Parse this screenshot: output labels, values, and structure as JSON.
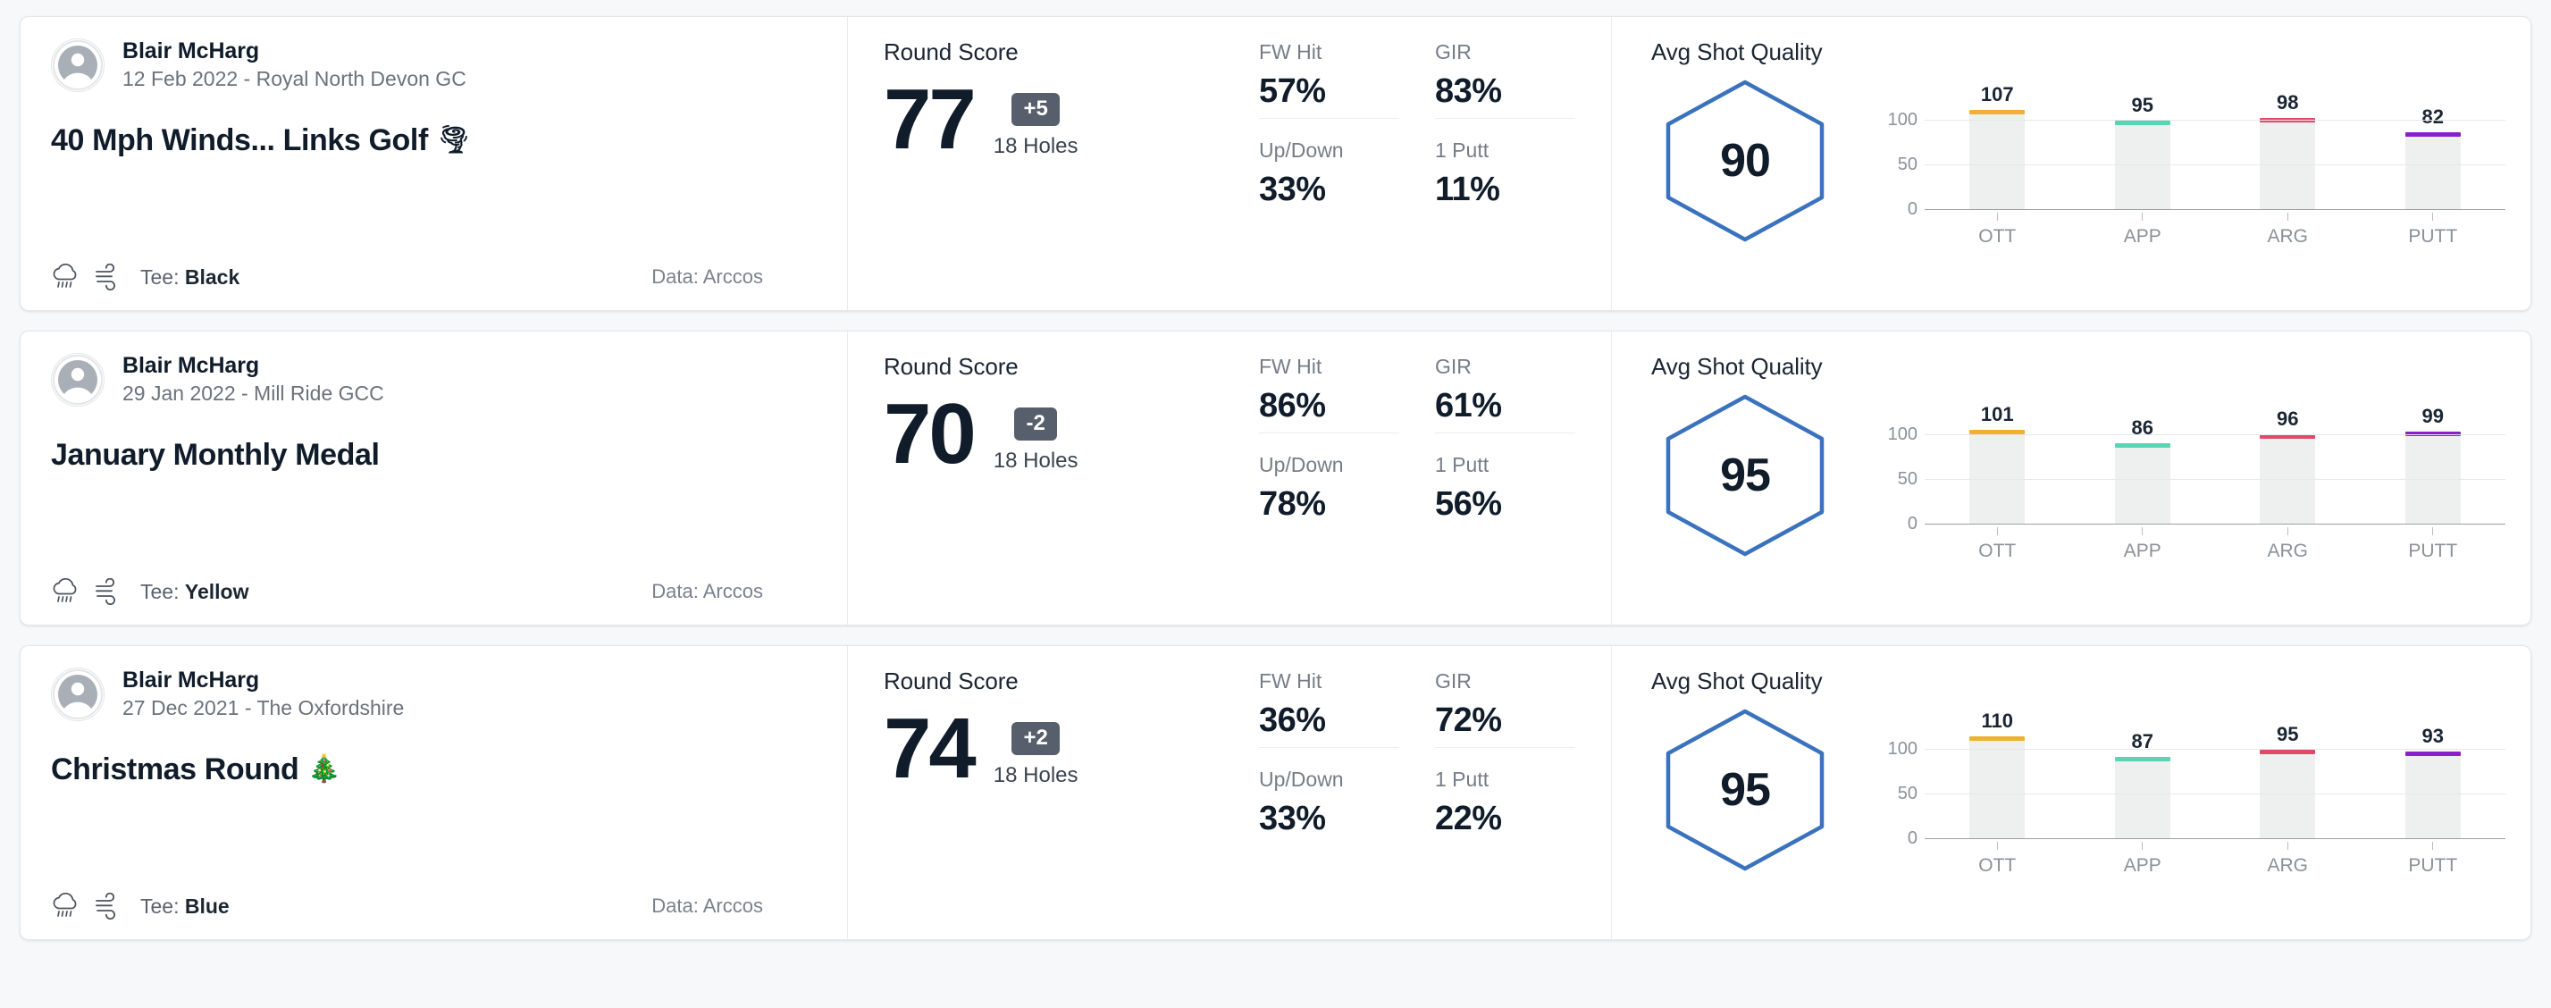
{
  "theme": {
    "accent_blue": "#3A72BE",
    "diff_badge_bg": "#565f6b",
    "page_bg": "#f7f8f9",
    "bar_bg": "#eeefef"
  },
  "chart_common": {
    "y_ticks": [
      "100",
      "50",
      "0"
    ],
    "categories": [
      "OTT",
      "APP",
      "ARG",
      "PUTT"
    ],
    "category_colors": [
      "#F0B132",
      "#5BD4B4",
      "#E24867",
      "#8B1FC9"
    ],
    "ylim": [
      0,
      130
    ],
    "heading": "Avg Shot Quality"
  },
  "labels": {
    "round_score": "Round Score",
    "holes": "18 Holes",
    "fw_hit": "FW Hit",
    "gir": "GIR",
    "up_down": "Up/Down",
    "one_putt": "1 Putt",
    "tee_prefix": "Tee: ",
    "data_source": "Data: Arccos",
    "avg_shot_quality": "Avg Shot Quality"
  },
  "rounds": [
    {
      "user": "Blair McHarg",
      "subtitle": "12 Feb 2022 - Royal North Devon GC",
      "title": "40 Mph Winds... Links Golf",
      "title_emoji": "🌪",
      "tee": "Black",
      "data_source": "Data: Arccos",
      "score": "77",
      "diff": "+5",
      "holes": "18 Holes",
      "stats": {
        "fw_hit": "57%",
        "gir": "83%",
        "up_down": "33%",
        "one_putt": "11%"
      },
      "avg_shot_quality": "90",
      "chart_data": {
        "type": "bar",
        "title": "Avg Shot Quality",
        "categories": [
          "OTT",
          "APP",
          "ARG",
          "PUTT"
        ],
        "values": [
          107,
          95,
          98,
          82
        ],
        "colors": [
          "#F0B132",
          "#5BD4B4",
          "#E24867",
          "#8B1FC9"
        ],
        "ylabel": "",
        "xlabel": "",
        "ylim": [
          0,
          130
        ],
        "yticks": [
          100,
          50,
          0
        ],
        "grid": true,
        "legend": "none"
      }
    },
    {
      "user": "Blair McHarg",
      "subtitle": "29 Jan 2022 - Mill Ride GCC",
      "title": "January Monthly Medal",
      "title_emoji": "",
      "tee": "Yellow",
      "data_source": "Data: Arccos",
      "score": "70",
      "diff": "-2",
      "holes": "18 Holes",
      "stats": {
        "fw_hit": "86%",
        "gir": "61%",
        "up_down": "78%",
        "one_putt": "56%"
      },
      "avg_shot_quality": "95",
      "chart_data": {
        "type": "bar",
        "title": "Avg Shot Quality",
        "categories": [
          "OTT",
          "APP",
          "ARG",
          "PUTT"
        ],
        "values": [
          101,
          86,
          96,
          99
        ],
        "colors": [
          "#F0B132",
          "#5BD4B4",
          "#E24867",
          "#8B1FC9"
        ],
        "ylabel": "",
        "xlabel": "",
        "ylim": [
          0,
          130
        ],
        "yticks": [
          100,
          50,
          0
        ],
        "grid": true,
        "legend": "none"
      }
    },
    {
      "user": "Blair McHarg",
      "subtitle": "27 Dec 2021 - The Oxfordshire",
      "title": "Christmas Round",
      "title_emoji": "🎄",
      "tee": "Blue",
      "data_source": "Data: Arccos",
      "score": "74",
      "diff": "+2",
      "holes": "18 Holes",
      "stats": {
        "fw_hit": "36%",
        "gir": "72%",
        "up_down": "33%",
        "one_putt": "22%"
      },
      "avg_shot_quality": "95",
      "chart_data": {
        "type": "bar",
        "title": "Avg Shot Quality",
        "categories": [
          "OTT",
          "APP",
          "ARG",
          "PUTT"
        ],
        "values": [
          110,
          87,
          95,
          93
        ],
        "colors": [
          "#F0B132",
          "#5BD4B4",
          "#E24867",
          "#8B1FC9"
        ],
        "ylabel": "",
        "xlabel": "",
        "ylim": [
          0,
          130
        ],
        "yticks": [
          100,
          50,
          0
        ],
        "grid": true,
        "legend": "none"
      }
    }
  ]
}
